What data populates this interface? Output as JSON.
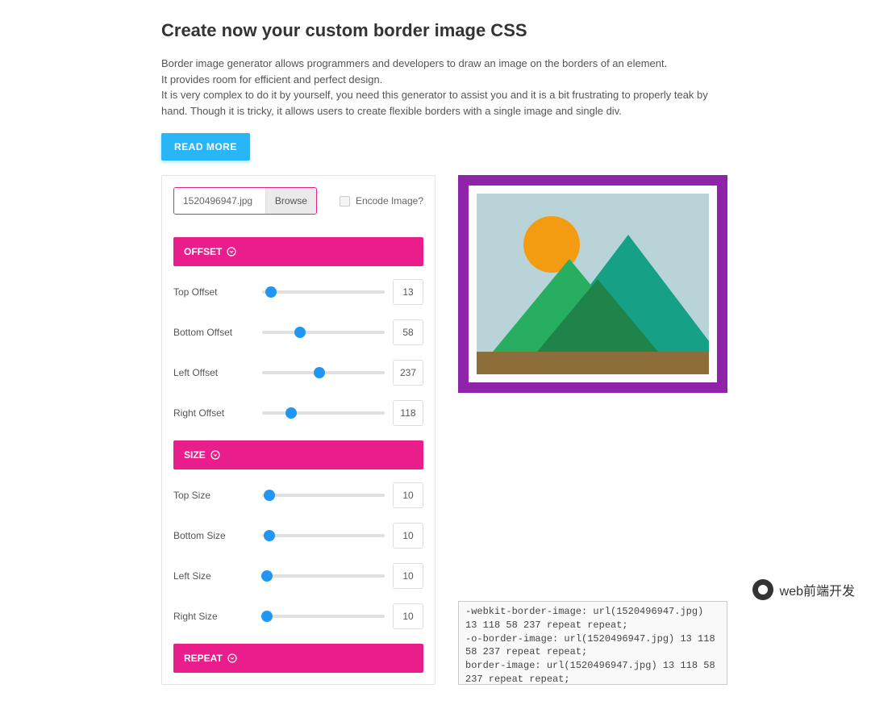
{
  "header": {
    "title": "Create now your custom border image CSS",
    "description": "Border image generator allows programmers and developers to draw an image on the borders of an element.\nIt provides room for efficient and perfect design.\nIt is very complex to do it by yourself, you need this generator to assist you and it is a bit frustrating to properly teak by hand. Though it is tricky, it allows users to create flexible borders with a single image and single div.",
    "read_more": "READ MORE"
  },
  "file": {
    "name": "1520496947.jpg",
    "browse": "Browse",
    "encode_label": "Encode Image?"
  },
  "sections": {
    "offset": {
      "title": "OFFSET",
      "controls": [
        {
          "label": "Top Offset",
          "value": "13",
          "pos": 7
        },
        {
          "label": "Bottom Offset",
          "value": "58",
          "pos": 31
        },
        {
          "label": "Left Offset",
          "value": "237",
          "pos": 47
        },
        {
          "label": "Right Offset",
          "value": "118",
          "pos": 24
        }
      ]
    },
    "size": {
      "title": "SIZE",
      "controls": [
        {
          "label": "Top Size",
          "value": "10",
          "pos": 6
        },
        {
          "label": "Bottom Size",
          "value": "10",
          "pos": 6
        },
        {
          "label": "Left Size",
          "value": "10",
          "pos": 4
        },
        {
          "label": "Right Size",
          "value": "10",
          "pos": 4
        }
      ]
    },
    "repeat": {
      "title": "REPEAT"
    }
  },
  "code_output": "-webkit-border-image: url(1520496947.jpg) 13 118 58 237 repeat repeat;\n-o-border-image: url(1520496947.jpg) 13 118 58 237 repeat repeat;\nborder-image: url(1520496947.jpg) 13 118 58 237 repeat repeat;\n}",
  "watermark": "web前端开发"
}
